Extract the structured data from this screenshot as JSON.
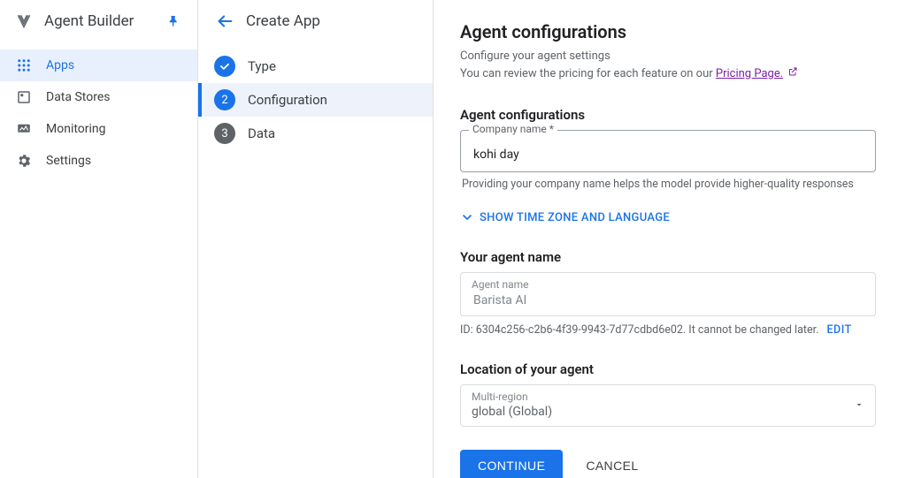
{
  "sidebar": {
    "title": "Agent Builder",
    "items": [
      {
        "label": "Apps",
        "icon": "apps-icon",
        "active": true
      },
      {
        "label": "Data Stores",
        "icon": "data-stores-icon",
        "active": false
      },
      {
        "label": "Monitoring",
        "icon": "monitoring-icon",
        "active": false
      },
      {
        "label": "Settings",
        "icon": "settings-icon",
        "active": false
      }
    ]
  },
  "header": {
    "title": "Create App"
  },
  "steps": [
    {
      "label": "Type",
      "state": "done"
    },
    {
      "label": "Configuration",
      "state": "current"
    },
    {
      "label": "Data",
      "state": "future"
    }
  ],
  "form": {
    "heading": "Agent configurations",
    "subline1": "Configure your agent settings",
    "subline2_prefix": "You can review the pricing for each feature on our ",
    "pricing_link_text": "Pricing Page.",
    "section_company_title": "Agent configurations",
    "company_field_label": "Company name *",
    "company_field_value": "kohi day",
    "company_helper": "Providing your company name helps the model provide higher-quality responses",
    "expander_label": "SHOW TIME ZONE AND LANGUAGE",
    "agent_name_title": "Your agent name",
    "agent_name_field_label": "Agent name",
    "agent_name_field_value": "Barista AI",
    "agent_id_prefix": "ID: ",
    "agent_id_value": "6304c256-c2b6-4f39-9943-7d77cdbd6e02",
    "agent_id_suffix": ". It cannot be changed later.",
    "edit_label": "EDIT",
    "location_title": "Location of your agent",
    "location_field_label": "Multi-region",
    "location_field_value": "global (Global)",
    "buttons": {
      "continue": "CONTINUE",
      "cancel": "CANCEL"
    }
  }
}
